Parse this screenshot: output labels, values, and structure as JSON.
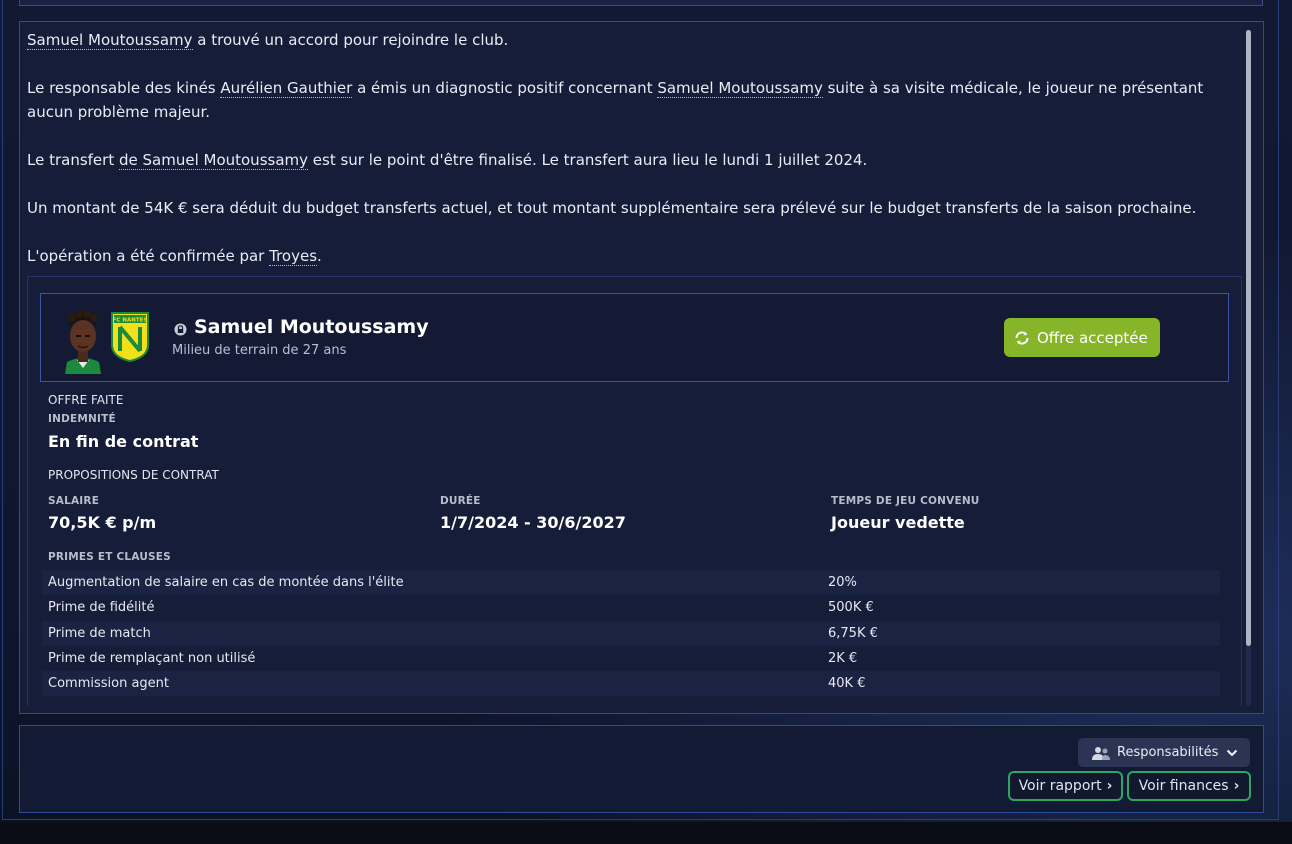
{
  "colors": {
    "accent_green": "#86b52a",
    "outline_green": "#2fa563",
    "panel_border": "#2f4a9a",
    "background": "#0d1324"
  },
  "message": {
    "p1": {
      "link": "Samuel Moutoussamy",
      "text": " a trouvé un accord pour rejoindre le club."
    },
    "p2": {
      "t1": "Le responsable des kinés ",
      "link1": "Aurélien Gauthier",
      "t2": " a émis un diagnostic positif concernant ",
      "link2": "Samuel Moutoussamy",
      "t3": " suite à sa visite médicale, le joueur ne présentant aucun problème majeur."
    },
    "p3": {
      "t1": "Le transfert ",
      "link": "de Samuel Moutoussamy",
      "t2": " est sur le point d'être finalisé. Le transfert aura lieu le lundi 1 juillet 2024."
    },
    "p4": "Un montant de 54K € sera déduit du budget transferts actuel, et tout montant supplémentaire sera prélevé sur le budget transferts de la saison prochaine.",
    "p5": {
      "t1": "L'opération a été confirmée par ",
      "link": "Troyes",
      "t2": "."
    }
  },
  "player": {
    "name": "Samuel Moutoussamy",
    "subtitle": "Milieu de terrain de 27 ans",
    "club_crest_text": "FC NANTES",
    "offer_status": "Offre acceptée",
    "offer_icon": "refresh-icon",
    "lock_icon": "lock-icon"
  },
  "offer": {
    "section_label": "OFFRE FAITE",
    "fee_label": "INDEMNITÉ",
    "fee_value": "En fin de contrat",
    "contract_section": "PROPOSITIONS DE CONTRAT",
    "salary_label": "SALAIRE",
    "salary_value": "70,5K € p/m",
    "duration_label": "DURÉE",
    "duration_value": "1/7/2024 - 30/6/2027",
    "playing_time_label": "TEMPS DE JEU CONVENU",
    "playing_time_value": "Joueur vedette",
    "clauses_label": "PRIMES ET CLAUSES",
    "clauses": [
      {
        "name": "Augmentation de salaire en cas de montée dans l'élite",
        "value": "20%"
      },
      {
        "name": "Prime de fidélité",
        "value": "500K €"
      },
      {
        "name": "Prime de match",
        "value": "6,75K €"
      },
      {
        "name": "Prime de remplaçant non utilisé",
        "value": "2K €"
      },
      {
        "name": "Commission agent",
        "value": "40K €"
      }
    ]
  },
  "actions": {
    "responsibilities": "Responsabilités",
    "view_report": "Voir rapport",
    "view_finances": "Voir finances"
  }
}
